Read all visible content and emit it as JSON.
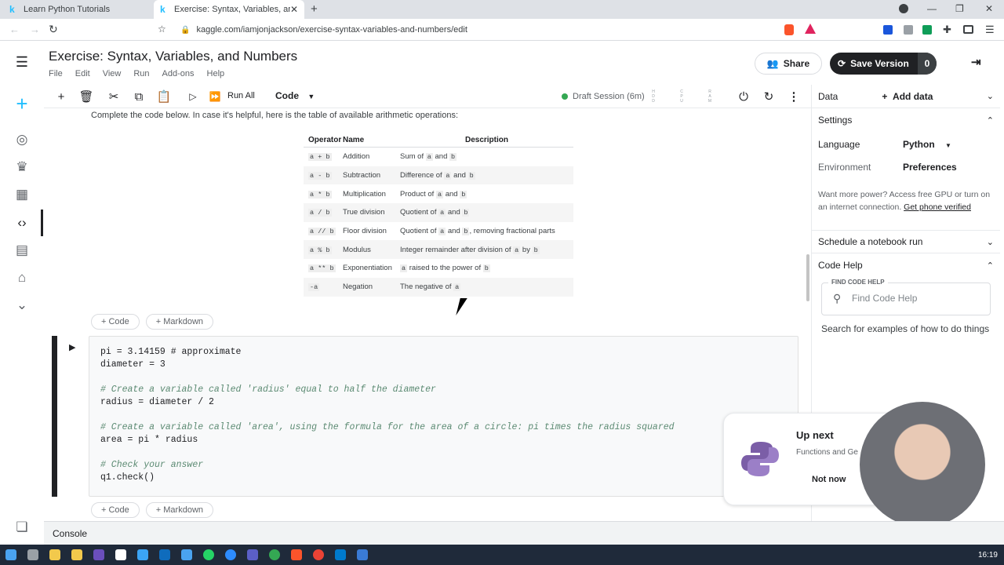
{
  "browser": {
    "tabs": [
      {
        "label": "Learn Python Tutorials",
        "favicon": "k"
      },
      {
        "label": "Exercise: Syntax, Variables, and N",
        "favicon": "k"
      }
    ],
    "new_tab": "+",
    "url": "kaggle.com/iamjonjackson/exercise-syntax-variables-and-numbers/edit",
    "window_controls": [
      "—",
      "❐",
      "✕"
    ]
  },
  "notebook": {
    "title": "Exercise: Syntax, Variables, and Numbers",
    "menu": [
      "File",
      "Edit",
      "View",
      "Run",
      "Add-ons",
      "Help"
    ],
    "share_label": "Share",
    "save_label": "Save Version",
    "save_count": "0",
    "toolbar": {
      "run_all": "Run All",
      "cell_type": "Code",
      "session": "Draft Session (6m)",
      "meters": [
        "H D D",
        "C P U",
        "R A M"
      ]
    },
    "intro": "Complete the code below. In case it's helpful, here is the table of available arithmetic operations:",
    "table": {
      "headers": [
        "Operator",
        "Name",
        "Description"
      ],
      "rows": [
        {
          "op": "a + b",
          "name": "Addition",
          "desc": [
            "Sum of ",
            "a",
            " and ",
            "b",
            ""
          ]
        },
        {
          "op": "a - b",
          "name": "Subtraction",
          "desc": [
            "Difference of ",
            "a",
            " and ",
            "b",
            ""
          ]
        },
        {
          "op": "a * b",
          "name": "Multiplication",
          "desc": [
            "Product of ",
            "a",
            " and ",
            "b",
            ""
          ]
        },
        {
          "op": "a / b",
          "name": "True division",
          "desc": [
            "Quotient of ",
            "a",
            " and ",
            "b",
            ""
          ]
        },
        {
          "op": "a // b",
          "name": "Floor division",
          "desc": [
            "Quotient of ",
            "a",
            " and ",
            "b",
            ", removing fractional parts"
          ]
        },
        {
          "op": "a % b",
          "name": "Modulus",
          "desc": [
            "Integer remainder after division of ",
            "a",
            " by ",
            "b",
            ""
          ]
        },
        {
          "op": "a ** b",
          "name": "Exponentiation",
          "desc": [
            "",
            "a",
            " raised to the power of ",
            "b",
            ""
          ]
        },
        {
          "op": "-a",
          "name": "Negation",
          "desc": [
            "The negative of ",
            "a",
            "",
            "",
            ""
          ]
        }
      ]
    },
    "add_code": "+ Code",
    "add_markdown": "+ Markdown",
    "code_lines": [
      "pi = 3.14159 # approximate",
      "diameter = 3",
      "",
      "# Create a variable called 'radius' equal to half the diameter",
      "radius = diameter / 2",
      "",
      "# Create a variable called 'area', using the formula for the area of a circle: pi times the radius squared",
      "area = pi * radius",
      "",
      "# Check your answer",
      "q1.check()"
    ],
    "console": "Console"
  },
  "panel": {
    "data_label": "Data",
    "add_data": "Add data",
    "settings": "Settings",
    "language_label": "Language",
    "language_value": "Python",
    "environment_label": "Environment",
    "environment_value": "Preferences",
    "power_text": "Want more power? Access free GPU or turn on an internet connection.",
    "power_link": "Get phone verified",
    "schedule": "Schedule a notebook run",
    "code_help": "Code Help",
    "find_label": "FIND CODE HELP",
    "find_placeholder": "Find Code Help",
    "search_hint": "Search for examples of how to do things"
  },
  "upnext": {
    "title": "Up next",
    "subtitle": "Functions and Ge",
    "dismiss": "Not now"
  },
  "taskbar": {
    "clock": "16:19"
  },
  "colors": {
    "kaggle_blue": "#20beff",
    "session_green": "#34a853",
    "save_dark": "#202124"
  }
}
